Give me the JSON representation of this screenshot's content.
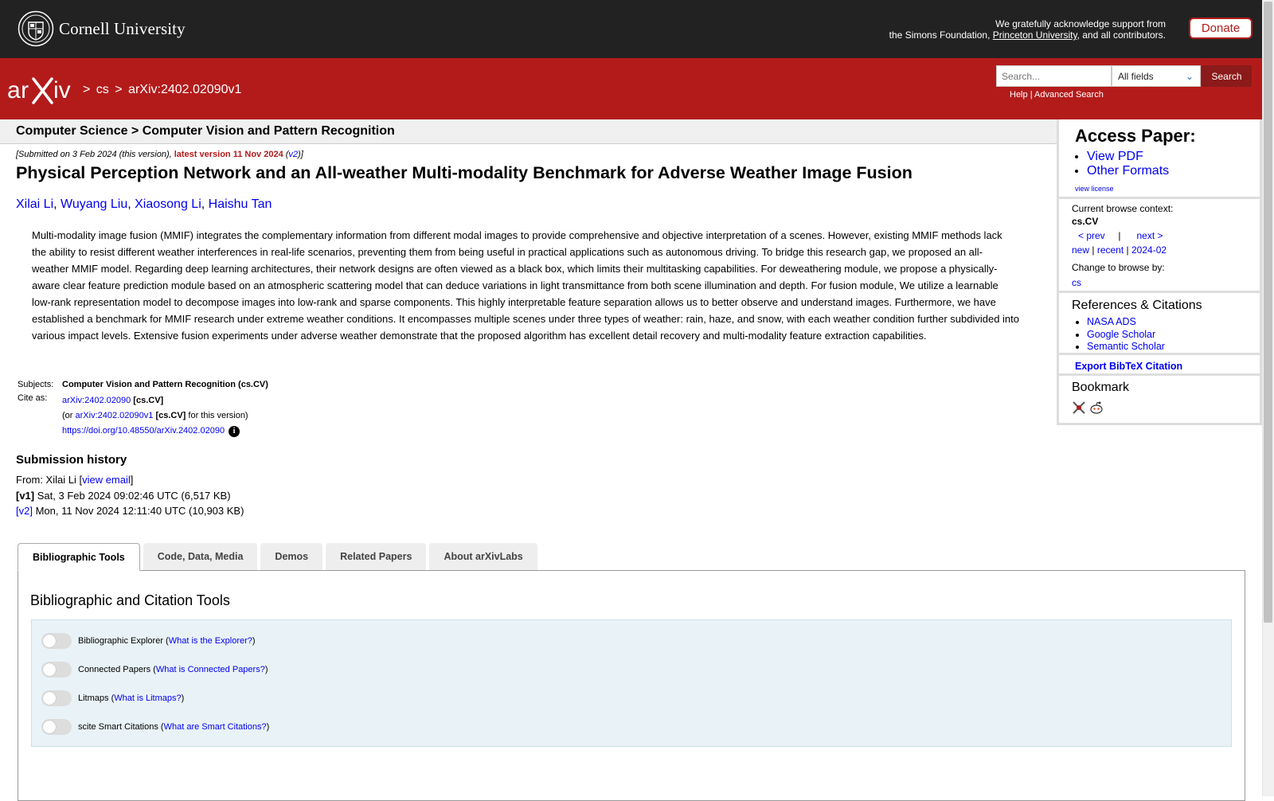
{
  "cornell": {
    "name": "Cornell University",
    "support_line1": "We gratefully acknowledge support from",
    "support_prefix": "the Simons Foundation,",
    "support_link": "Princeton University",
    "support_suffix": ", and all contributors.",
    "donate": "Donate"
  },
  "header": {
    "logo_text": "arXiv",
    "crumb_sep1": ">",
    "crumb_cs": "cs",
    "crumb_sep2": ">",
    "crumb_id": "arXiv:2402.02090v1",
    "search_placeholder": "Search...",
    "search_field": "All fields",
    "search_button": "Search",
    "help": "Help",
    "sep": "|",
    "advanced": "Advanced Search"
  },
  "subject_bar": "Computer Science > Computer Vision and Pattern Recognition",
  "submitted": {
    "prefix": "[Submitted on 3 Feb 2024 (this version), ",
    "latest": "latest version 11 Nov 2024",
    "open": " (",
    "v2": "v2",
    "close": ")]"
  },
  "paper": {
    "title": "Physical Perception Network and an All-weather Multi-modality Benchmark for Adverse Weather Image Fusion",
    "authors": [
      "Xilai Li",
      "Wuyang Liu",
      "Xiaosong Li",
      "Haishu Tan"
    ],
    "abstract": "Multi-modality image fusion (MMIF) integrates the complementary information from different modal images to provide comprehensive and objective interpretation of a scenes. However, existing MMIF methods lack the ability to resist different weather interferences in real-life scenarios, preventing them from being useful in practical applications such as autonomous driving. To bridge this research gap, we proposed an all-weather MMIF model. Regarding deep learning architectures, their network designs are often viewed as a black box, which limits their multitasking capabilities. For deweathering module, we propose a physically-aware clear feature prediction module based on an atmospheric scattering model that can deduce variations in light transmittance from both scene illumination and depth. For fusion module, We utilize a learnable low-rank representation model to decompose images into low-rank and sparse components. This highly interpretable feature separation allows us to better observe and understand images. Furthermore, we have established a benchmark for MMIF research under extreme weather conditions. It encompasses multiple scenes under three types of weather: rain, haze, and snow, with each weather condition further subdivided into various impact levels. Extensive fusion experiments under adverse weather demonstrate that the proposed algorithm has excellent detail recovery and multi-modality feature extraction capabilities."
  },
  "meta": {
    "subjects_label": "Subjects:",
    "subjects_value": "Computer Vision and Pattern Recognition (cs.CV)",
    "cite_label": "Cite as:",
    "cite_id": "arXiv:2402.02090",
    "cite_cat": "[cs.CV]",
    "cite_or": "(or",
    "cite_v1": "arXiv:2402.02090v1",
    "cite_cat2": "[cs.CV]",
    "cite_this": "for this version)",
    "doi": "https://doi.org/10.48550/arXiv.2402.02090",
    "info_glyph": "i"
  },
  "history": {
    "title": "Submission history",
    "from_prefix": "From: Xilai Li [",
    "view_email": "view email",
    "from_suffix": "]",
    "v1_label": "[v1]",
    "v1_text": "Sat, 3 Feb 2024 09:02:46 UTC (6,517 KB)",
    "v2_label": "[v2]",
    "v2_text": "Mon, 11 Nov 2024 12:11:40 UTC (10,903 KB)"
  },
  "sidebar": {
    "access_title": "Access Paper:",
    "view_pdf": "View PDF",
    "other_formats": "Other Formats",
    "view_license": "view license",
    "browse_context_label": "Current browse context:",
    "browse_context": "cs.CV",
    "prev": "< prev",
    "pipe": "|",
    "next": "next >",
    "new": "new",
    "recent": "recent",
    "month": "2024-02",
    "change_label": "Change to browse by:",
    "change_cs": "cs",
    "refs_title": "References & Citations",
    "refs": [
      "NASA ADS",
      "Google Scholar",
      "Semantic Scholar"
    ],
    "export": "Export BibTeX Citation",
    "bookmark_title": "Bookmark"
  },
  "tabs": [
    "Bibliographic Tools",
    "Code, Data, Media",
    "Demos",
    "Related Papers",
    "About arXivLabs"
  ],
  "panel": {
    "title": "Bibliographic and Citation Tools",
    "tools": [
      {
        "name": "Bibliographic Explorer",
        "link": "What is the Explorer?"
      },
      {
        "name": "Connected Papers",
        "link": "What is Connected Papers?"
      },
      {
        "name": "Litmaps",
        "link": "What is Litmaps?"
      },
      {
        "name": "scite Smart Citations",
        "link": "What are Smart Citations?"
      }
    ]
  },
  "colors": {
    "arxiv_red": "#b31b1b",
    "cornell_dark": "#222222",
    "link_blue": "#0000ee"
  }
}
